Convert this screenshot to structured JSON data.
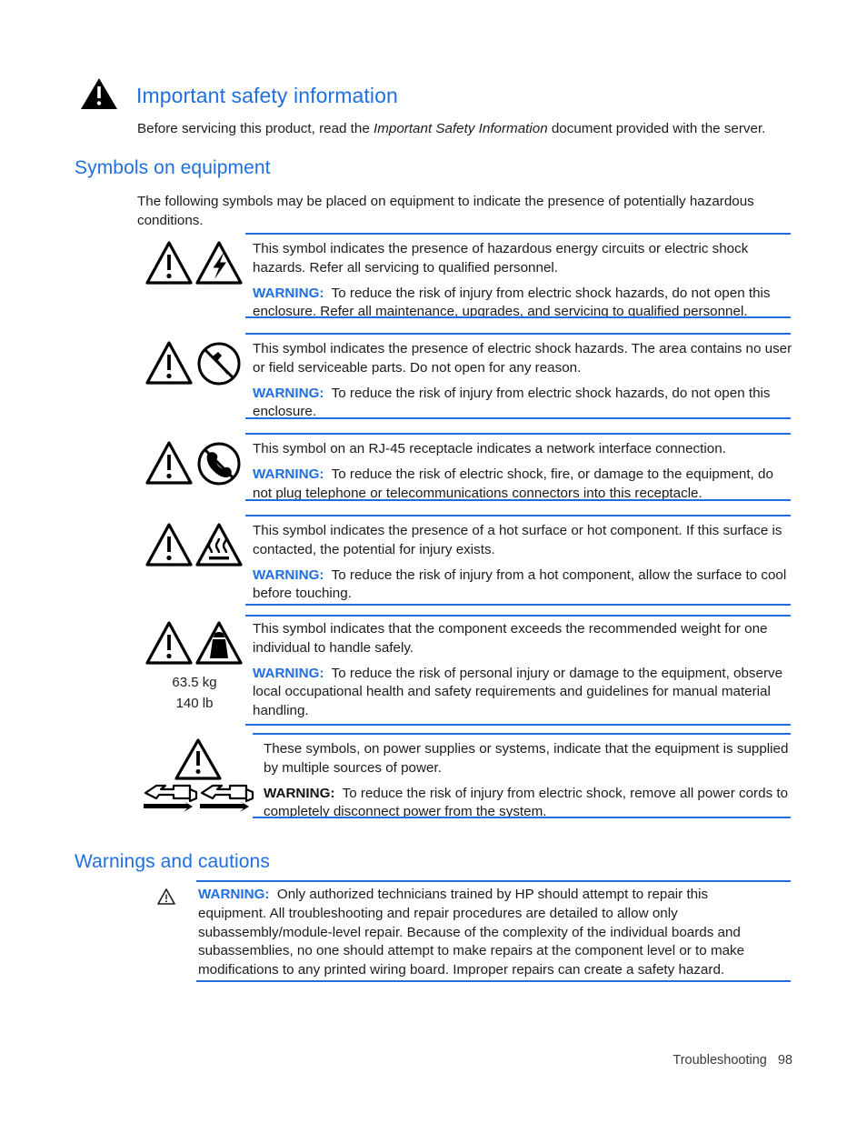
{
  "document": {
    "section_important": {
      "icon": "warning-triangle-solid-icon",
      "heading": "Important safety information",
      "paragraph_prefix": "Before servicing this product, read the ",
      "paragraph_italic": "Important Safety Information",
      "paragraph_suffix": " document provided with the server."
    },
    "section_symbols": {
      "heading": "Symbols on equipment",
      "intro": "The following symbols may be placed on equipment to indicate the presence of potentially hazardous conditions.",
      "rows": [
        {
          "icons": [
            "warning-exclamation-triangle-icon",
            "electric-shock-lightning-triangle-icon"
          ],
          "description": "This symbol indicates the presence of hazardous energy circuits or electric shock hazards. Refer all servicing to qualified personnel.",
          "warning_label": "WARNING:",
          "warning_label_color": "#1f6fe0",
          "warning_text": "To reduce the risk of injury from electric shock hazards, do not open this enclosure. Refer all maintenance, upgrades, and servicing to qualified personnel."
        },
        {
          "icons": [
            "warning-exclamation-triangle-icon",
            "no-screwdriver-circle-icon"
          ],
          "description": "This symbol indicates the presence of electric shock hazards. The area contains no user or field serviceable parts. Do not open for any reason.",
          "warning_label": "WARNING:",
          "warning_label_color": "#1f6fe0",
          "warning_text": "To reduce the risk of injury from electric shock hazards, do not open this enclosure."
        },
        {
          "icons": [
            "warning-exclamation-triangle-icon",
            "no-telephone-circle-icon"
          ],
          "description": "This symbol on an RJ-45 receptacle indicates a network interface connection.",
          "warning_label": "WARNING:",
          "warning_label_color": "#1f6fe0",
          "warning_text": "To reduce the risk of electric shock, fire, or damage to the equipment, do not plug telephone or telecommunications connectors into this receptacle."
        },
        {
          "icons": [
            "warning-exclamation-triangle-icon",
            "hot-surface-triangle-icon"
          ],
          "description": "This symbol indicates the presence of a hot surface or hot component. If this surface is contacted, the potential for injury exists.",
          "warning_label": "WARNING:",
          "warning_label_color": "#1f6fe0",
          "warning_text": "To reduce the risk of injury from a hot component, allow the surface to cool before touching."
        },
        {
          "icons": [
            "warning-exclamation-triangle-icon",
            "heavy-weight-triangle-icon"
          ],
          "weight_metric": "63.5 kg",
          "weight_imperial": "140 lb",
          "description": "This symbol indicates that the component exceeds the recommended weight for one individual to handle safely.",
          "warning_label": "WARNING:",
          "warning_label_color": "#1f6fe0",
          "warning_text": "To reduce the risk of personal injury or damage to the equipment, observe local occupational health and safety requirements and guidelines for manual material handling."
        },
        {
          "icons": [
            "warning-exclamation-triangle-icon",
            "power-cord-plug-icon",
            "power-cord-plug-icon"
          ],
          "description": "These symbols, on power supplies or systems, indicate that the equipment is supplied by multiple sources of power.",
          "warning_label": "WARNING:",
          "warning_label_color": "#111111",
          "warning_text": "To reduce the risk of injury from electric shock, remove all power cords to completely disconnect power from the system."
        }
      ]
    },
    "section_warnings_cautions": {
      "heading": "Warnings and cautions",
      "icon": "warning-triangle-outline-icon",
      "warning_label": "WARNING:",
      "warning_text": "Only authorized technicians trained by HP should attempt to repair this equipment. All troubleshooting and repair procedures are detailed to allow only subassembly/module-level repair. Because of the complexity of the individual boards and subassemblies, no one should attempt to make repairs at the component level or to make modifications to any printed wiring board. Improper repairs can create a safety hazard."
    },
    "footer": {
      "chapter": "Troubleshooting",
      "page_number": "98"
    },
    "colors": {
      "heading_blue": "#1f6fe0",
      "rule_blue": "#1f6fe0",
      "body_black": "#1c1c1c"
    }
  }
}
